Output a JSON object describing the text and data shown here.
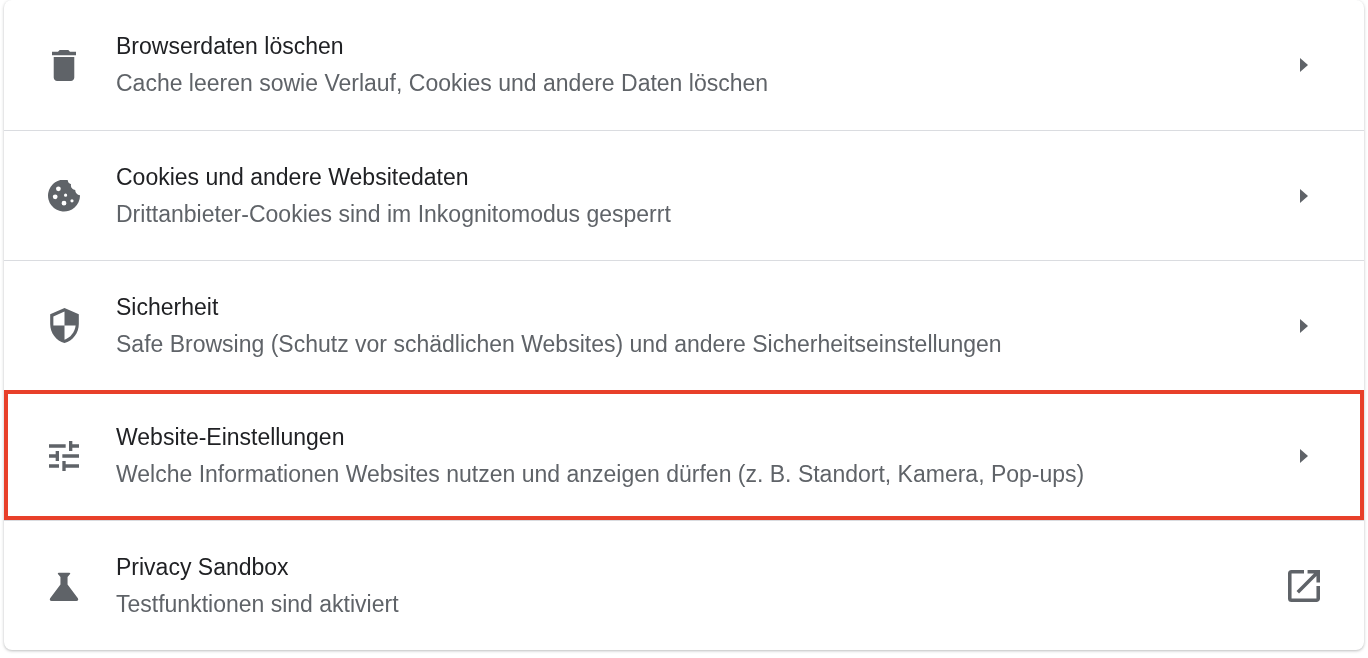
{
  "items": [
    {
      "title": "Browserdaten löschen",
      "subtitle": "Cache leeren sowie Verlauf, Cookies und andere Daten löschen",
      "kind": "arrow",
      "highlighted": false
    },
    {
      "title": "Cookies und andere Websitedaten",
      "subtitle": "Drittanbieter-Cookies sind im Inkognitomodus gesperrt",
      "kind": "arrow",
      "highlighted": false
    },
    {
      "title": "Sicherheit",
      "subtitle": "Safe Browsing (Schutz vor schädlichen Websites) und andere Sicherheitseinstellungen",
      "kind": "arrow",
      "highlighted": false
    },
    {
      "title": "Website-Einstellungen",
      "subtitle": "Welche Informationen Websites nutzen und anzeigen dürfen (z. B. Standort, Kamera, Pop-ups)",
      "kind": "arrow",
      "highlighted": true
    },
    {
      "title": "Privacy Sandbox",
      "subtitle": "Testfunktionen sind aktiviert",
      "kind": "external",
      "highlighted": false
    }
  ]
}
